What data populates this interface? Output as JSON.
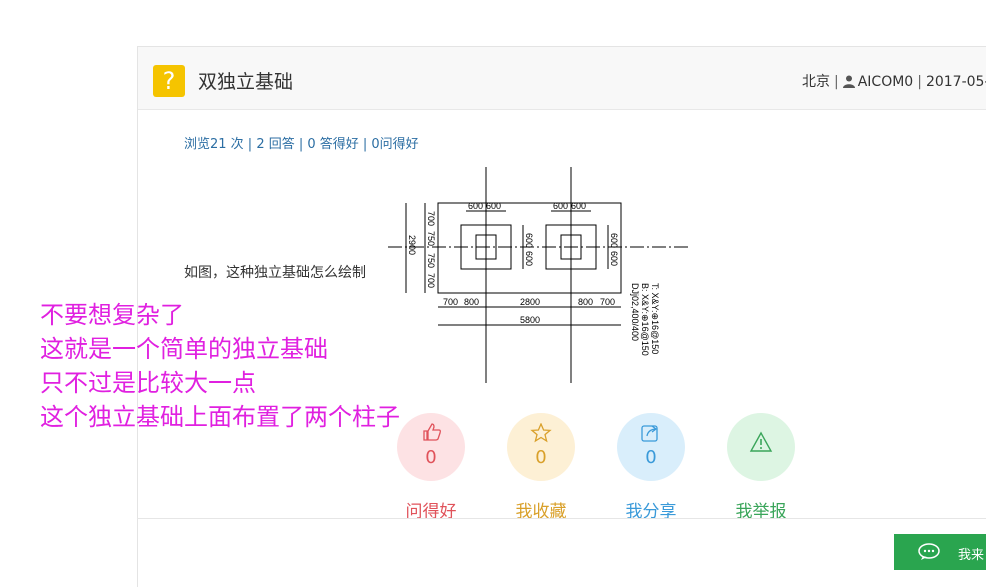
{
  "question": {
    "icon": "question-mark-icon",
    "title": "双独立基础",
    "location": "北京",
    "user": "AICOM0",
    "date": "2017-05-"
  },
  "stats": "浏览21 次 | 2 回答 | 0 答得好 | 0问得好",
  "body_text": "如图，这种独立基础怎么绘制",
  "drawing": {
    "top_dims_left": [
      "600",
      "600"
    ],
    "top_dims_right": [
      "600",
      "600"
    ],
    "left_dims": [
      "700",
      "750",
      "750",
      "700"
    ],
    "left_total": "2900",
    "mid_dims": [
      "600",
      "600"
    ],
    "right_dims": [
      "600",
      "600"
    ],
    "bottom_dims": [
      "700",
      "800",
      "2800",
      "800",
      "700"
    ],
    "bottom_total": "5800",
    "note_lines": [
      "DJj02,400/400",
      "B: X&Y:⊕16@150",
      "T: X&Y:⊕16@150"
    ]
  },
  "overlay_lines": [
    "不要想复杂了",
    "这就是一个简单的独立基础",
    "只不过是比较大一点",
    "这个独立基础上面布置了两个柱子"
  ],
  "actions": [
    {
      "label": "问得好",
      "count": "0",
      "icon": "thumbs-up-icon",
      "color": "#e0525a",
      "bg": "#fde2e4"
    },
    {
      "label": "我收藏",
      "count": "0",
      "icon": "star-icon",
      "color": "#d9a02a",
      "bg": "#fdf0d5"
    },
    {
      "label": "我分享",
      "count": "0",
      "icon": "share-icon",
      "color": "#3a9ad9",
      "bg": "#d9eefb"
    },
    {
      "label": "我举报",
      "count": "0",
      "icon": "warning-icon",
      "color": "#3aa55a",
      "bg": "#ddf5e3"
    }
  ],
  "chat_button": {
    "label": "我来",
    "icon": "chat-bubble-icon"
  }
}
